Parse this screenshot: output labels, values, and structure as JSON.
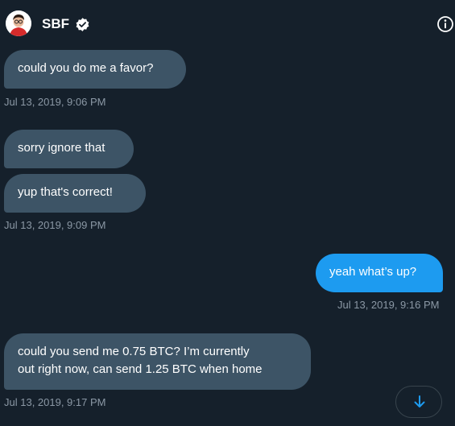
{
  "header": {
    "contact_name": "SBF",
    "avatar_icon": "avatar-icon",
    "verified_icon": "verified-badge-icon",
    "info_icon": "info-icon"
  },
  "conversation": {
    "messages": [
      {
        "direction": "received",
        "text": "could you do me a favor?"
      },
      {
        "direction": "received",
        "text": "sorry ignore that"
      },
      {
        "direction": "received",
        "text": "yup that's correct!"
      },
      {
        "direction": "sent",
        "text": "yeah what’s up?"
      },
      {
        "direction": "received",
        "text_lines": [
          "could you send me 0.75 BTC? I’m currently",
          "out right now, can send 1.25 BTC when home"
        ]
      }
    ],
    "timestamps": [
      "Jul 13, 2019, 9:06 PM",
      "Jul 13, 2019, 9:09 PM",
      "Jul 13, 2019, 9:16 PM",
      "Jul 13, 2019, 9:17 PM"
    ]
  },
  "controls": {
    "scroll_down_icon": "arrow-down-icon"
  },
  "colors": {
    "background": "#15202b",
    "received_bubble": "#3d5466",
    "sent_bubble": "#1d9bf0",
    "timestamp_text": "#8b98a5",
    "accent": "#1d9bf0"
  }
}
